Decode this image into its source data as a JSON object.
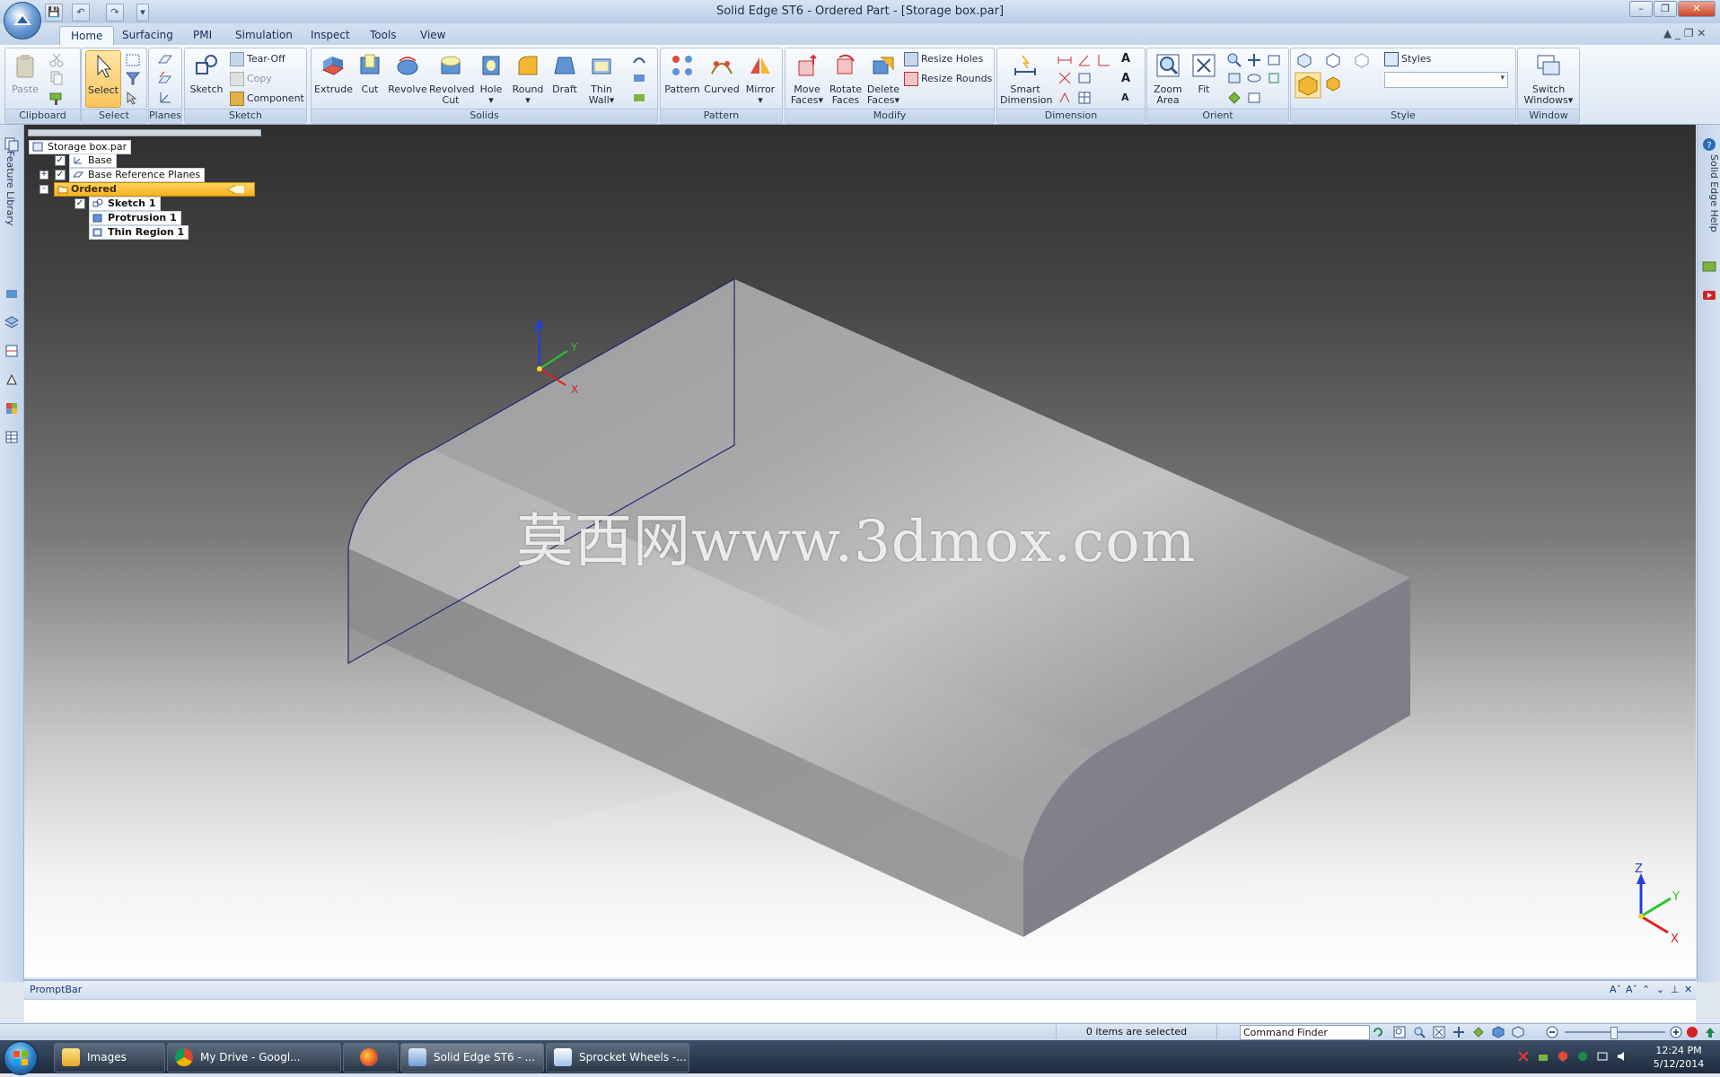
{
  "window": {
    "title": "Solid Edge ST6 - Ordered Part - [Storage box.par]",
    "qat_undo_label": "Undo",
    "qat_redo_label": "Redo"
  },
  "tabs": [
    {
      "label": "Home"
    },
    {
      "label": "Surfacing"
    },
    {
      "label": "PMI"
    },
    {
      "label": "Simulation"
    },
    {
      "label": "Inspect"
    },
    {
      "label": "Tools"
    },
    {
      "label": "View"
    }
  ],
  "ribbon": {
    "clipboard": {
      "label": "Clipboard",
      "paste": "Paste"
    },
    "select": {
      "label": "Select",
      "select": "Select"
    },
    "planes": {
      "label": "Planes"
    },
    "sketch": {
      "label": "Sketch",
      "sketch": "Sketch",
      "tear_off": "Tear-Off",
      "copy": "Copy",
      "component": "Component"
    },
    "solids": {
      "label": "Solids",
      "extrude": "Extrude",
      "cut": "Cut",
      "revolve": "Revolve",
      "revolved_cut_1": "Revolved",
      "revolved_cut_2": "Cut",
      "hole": "Hole",
      "round": "Round",
      "draft": "Draft",
      "thin_wall_1": "Thin",
      "thin_wall_2": "Wall"
    },
    "pattern": {
      "label": "Pattern",
      "pattern": "Pattern",
      "curved": "Curved",
      "mirror": "Mirror"
    },
    "modify": {
      "label": "Modify",
      "move_1": "Move",
      "move_2": "Faces",
      "rotate_1": "Rotate",
      "rotate_2": "Faces",
      "delete_1": "Delete",
      "delete_2": "Faces",
      "resize_holes": "Resize Holes",
      "resize_rounds": "Resize Rounds"
    },
    "dimension": {
      "label": "Dimension",
      "smart_1": "Smart",
      "smart_2": "Dimension"
    },
    "orient": {
      "label": "Orient",
      "zoom_1": "Zoom",
      "zoom_2": "Area",
      "fit": "Fit"
    },
    "style": {
      "label": "Style",
      "styles": "Styles"
    },
    "window": {
      "label": "Window",
      "switch_1": "Switch",
      "switch_2": "Windows"
    }
  },
  "sidebars": {
    "feature_library": "Feature Library",
    "help": "Solid Edge Help"
  },
  "tree": {
    "root": "Storage box.par",
    "base": "Base",
    "base_planes": "Base Reference Planes",
    "ordered": "Ordered",
    "sketch1": "Sketch 1",
    "protrusion1": "Protrusion 1",
    "thin_region1": "Thin Region 1"
  },
  "triad": {
    "z": "Z",
    "y": "Y",
    "x": "X"
  },
  "watermark": "莫西网www.3dmox.com",
  "promptbar": {
    "title": "PromptBar"
  },
  "statusbar": {
    "selection": "0 items are selected",
    "command_finder": "Command Finder",
    "zoom_level": 0.48
  },
  "taskbar": {
    "items": [
      {
        "label": "Images"
      },
      {
        "label": "My Drive - Googl..."
      },
      {
        "label": ""
      },
      {
        "label": "Solid Edge ST6 - ..."
      },
      {
        "label": "Sprocket Wheels -..."
      }
    ],
    "time": "12:24 PM",
    "date": "5/12/2014"
  },
  "colors": {
    "accent": "#f6b21e",
    "ribbon_bg": "#dce7f4",
    "model_face": "#a3a3a5",
    "triad_x": "#e01f1f",
    "triad_y": "#27c92a",
    "triad_z": "#1f3fe0"
  }
}
